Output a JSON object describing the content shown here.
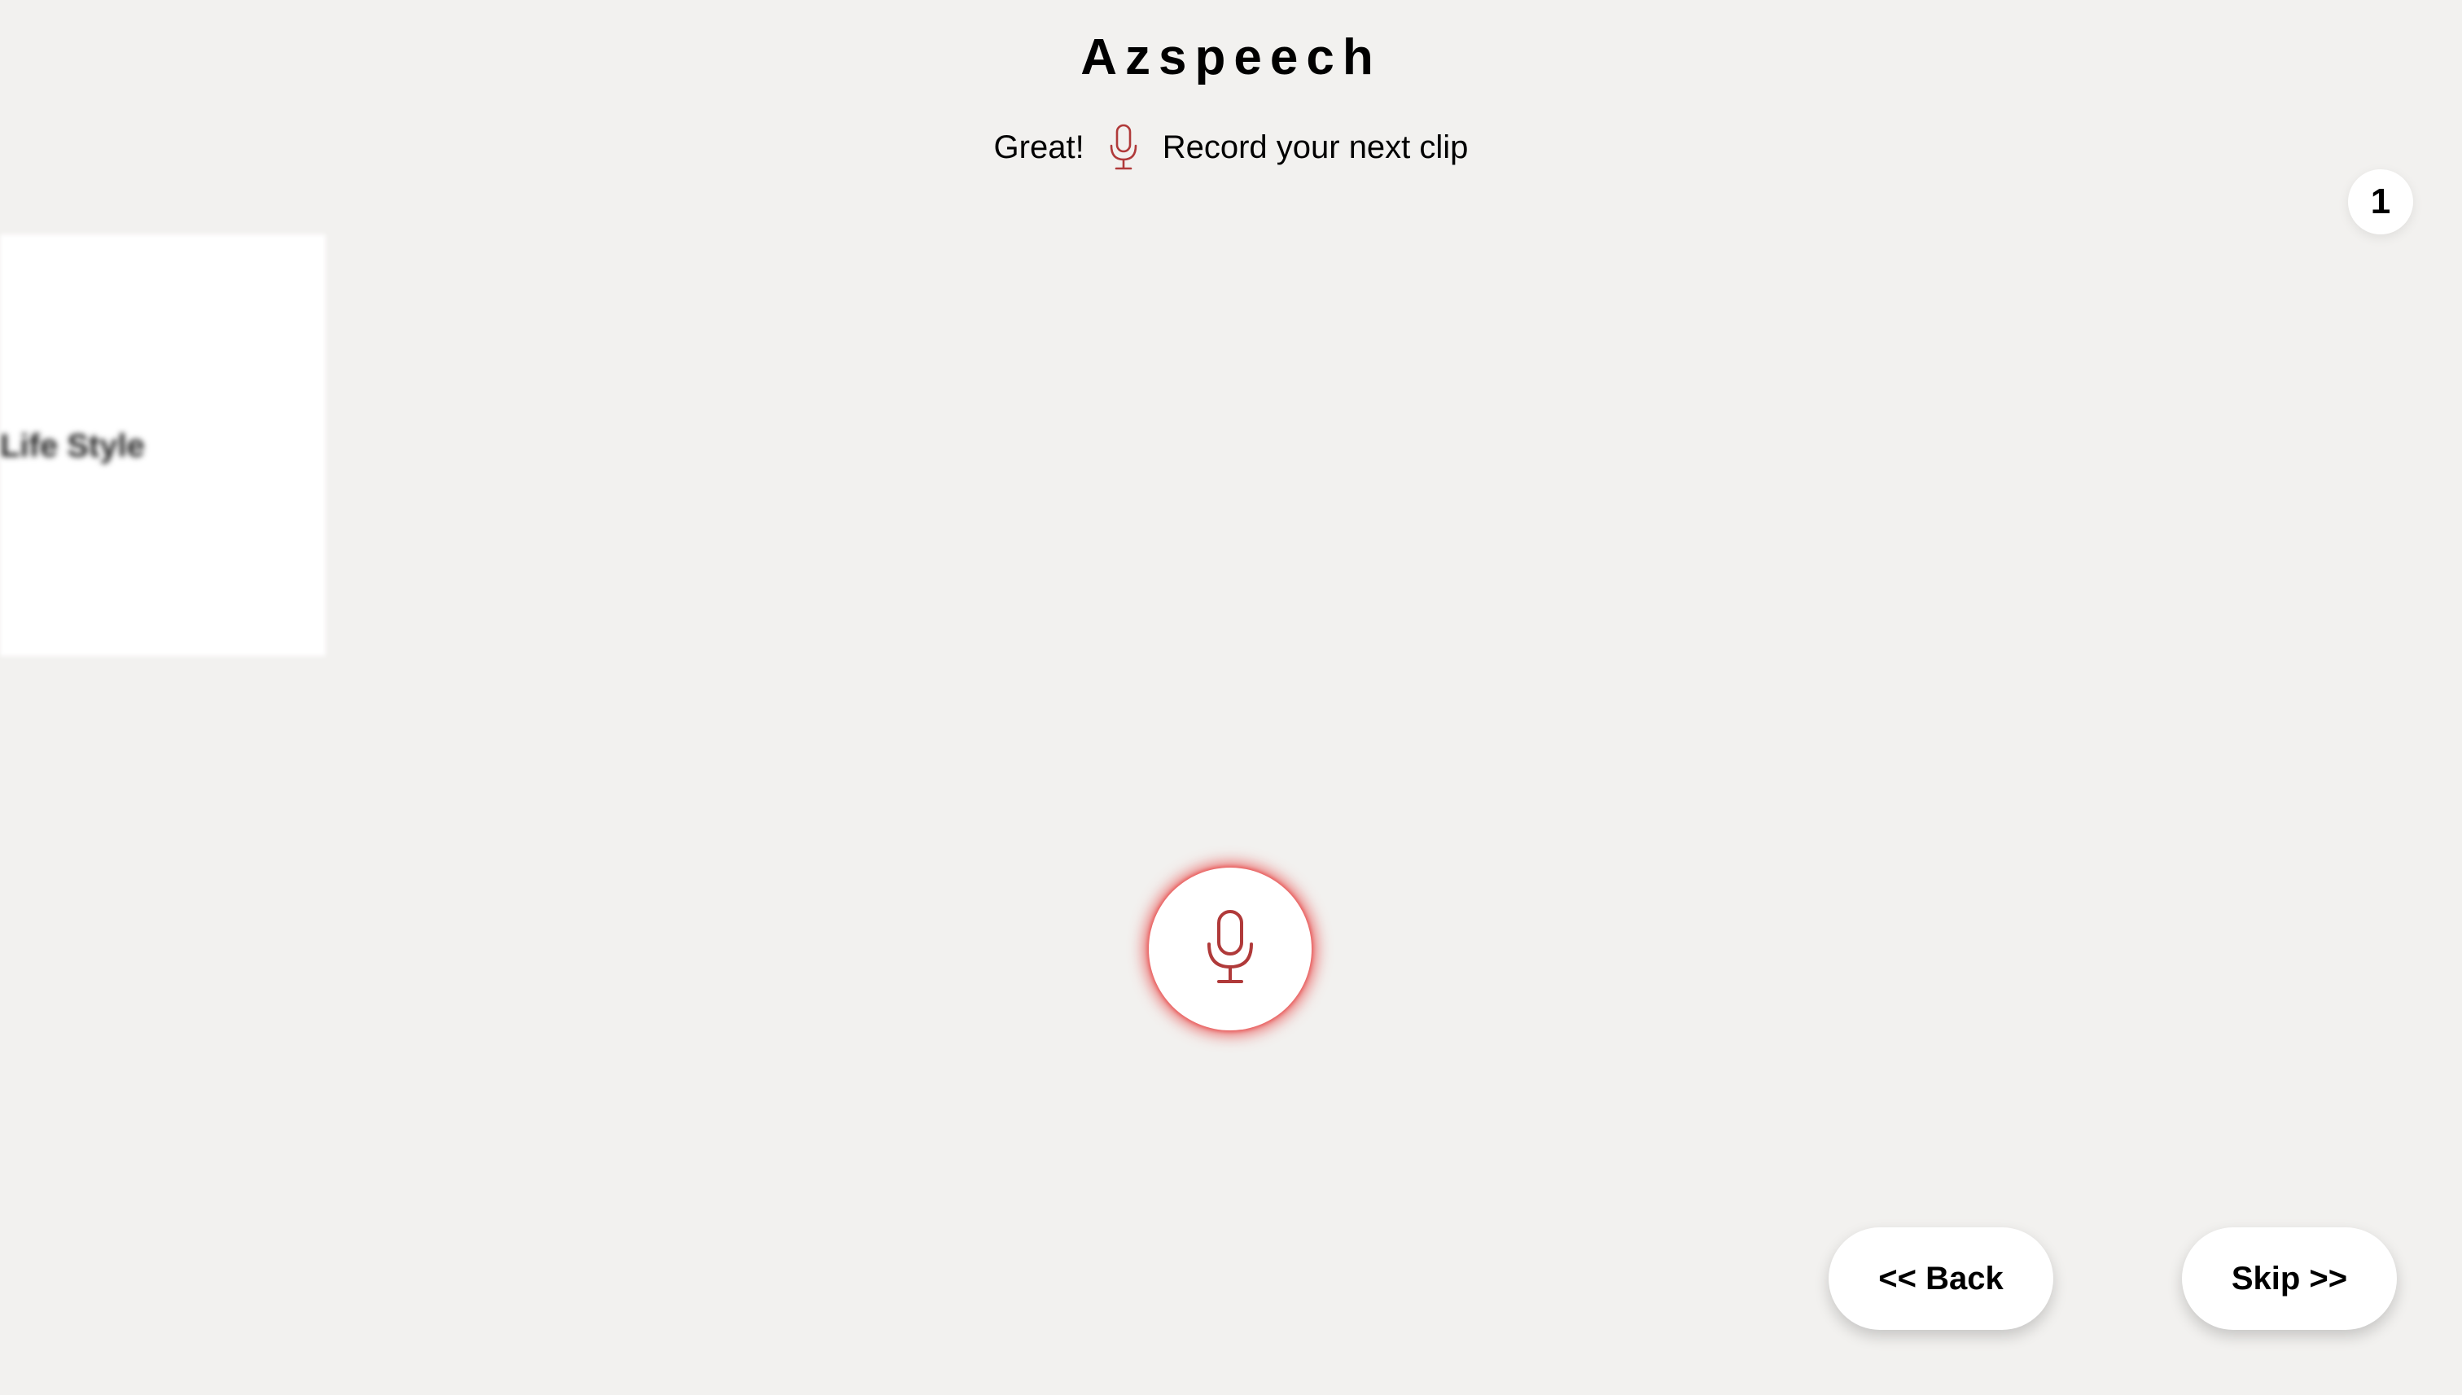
{
  "header": {
    "title": "Azspeech"
  },
  "prompt": {
    "prefix": "Great!",
    "suffix": "Record your next clip",
    "icon": "microphone-icon"
  },
  "counter": {
    "value": "1"
  },
  "category_card": {
    "label": "Life Style"
  },
  "record": {
    "icon": "microphone-icon",
    "glow_color": "#e84040"
  },
  "navigation": {
    "back_label": "<< Back",
    "skip_label": "Skip >>"
  },
  "colors": {
    "background": "#f2f1ef",
    "accent": "#b03a3a"
  }
}
